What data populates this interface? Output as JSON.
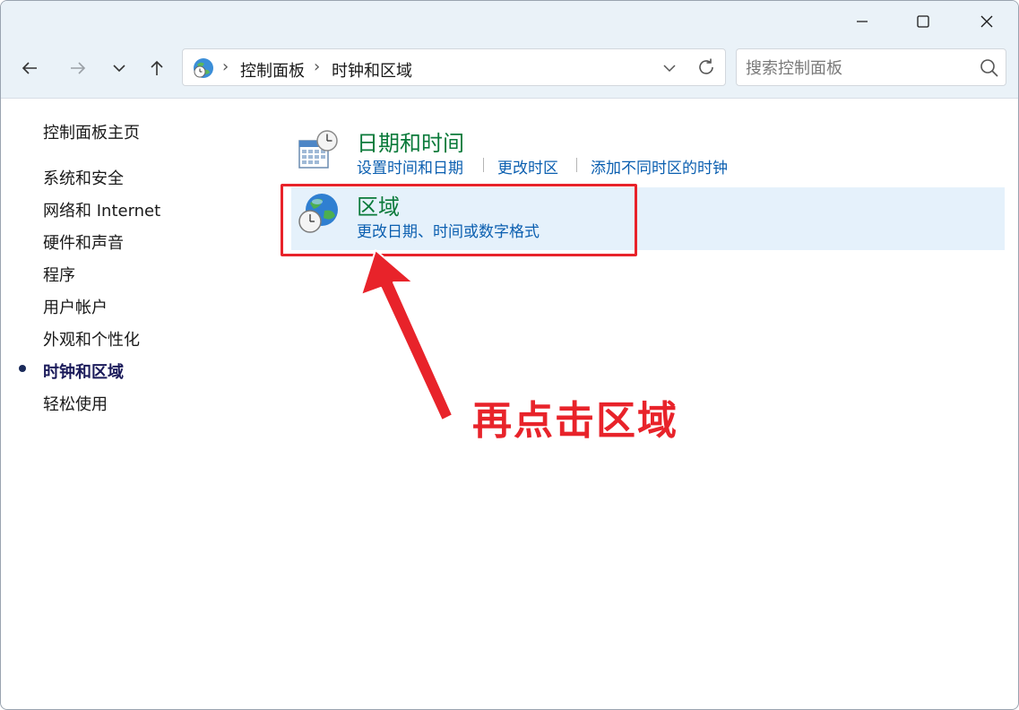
{
  "window": {
    "controls": {
      "minimize_icon": "minimize-icon",
      "maximize_icon": "maximize-icon",
      "close_icon": "close-icon"
    }
  },
  "nav": {
    "back_icon": "arrow-left-icon",
    "forward_icon": "arrow-right-icon",
    "recent_icon": "chevron-down-icon",
    "up_icon": "arrow-up-icon"
  },
  "address": {
    "crumbs": [
      "控制面板",
      "时钟和区域"
    ],
    "separator": "›"
  },
  "search": {
    "placeholder": "搜索控制面板"
  },
  "sidebar": {
    "home": "控制面板主页",
    "items": [
      {
        "label": "系统和安全",
        "active": false
      },
      {
        "label": "网络和 Internet",
        "active": false
      },
      {
        "label": "硬件和声音",
        "active": false
      },
      {
        "label": "程序",
        "active": false
      },
      {
        "label": "用户帐户",
        "active": false
      },
      {
        "label": "外观和个性化",
        "active": false
      },
      {
        "label": "时钟和区域",
        "active": true
      },
      {
        "label": "轻松使用",
        "active": false
      }
    ]
  },
  "categories": [
    {
      "title": "日期和时间",
      "icon": "calendar-clock-icon",
      "links": [
        "设置时间和日期",
        "更改时区",
        "添加不同时区的时钟"
      ]
    },
    {
      "title": "区域",
      "icon": "globe-clock-icon",
      "links": [
        "更改日期、时间或数字格式"
      ],
      "highlighted": true
    }
  ],
  "annotation": {
    "text": "再点击区域",
    "color": "#e8232a"
  },
  "colors": {
    "chrome": "#eaf2f8",
    "category_title": "#0a7a3a",
    "link": "#0b5fb0",
    "highlight": "#e5f1fb",
    "annotation_red": "#e8232a"
  }
}
